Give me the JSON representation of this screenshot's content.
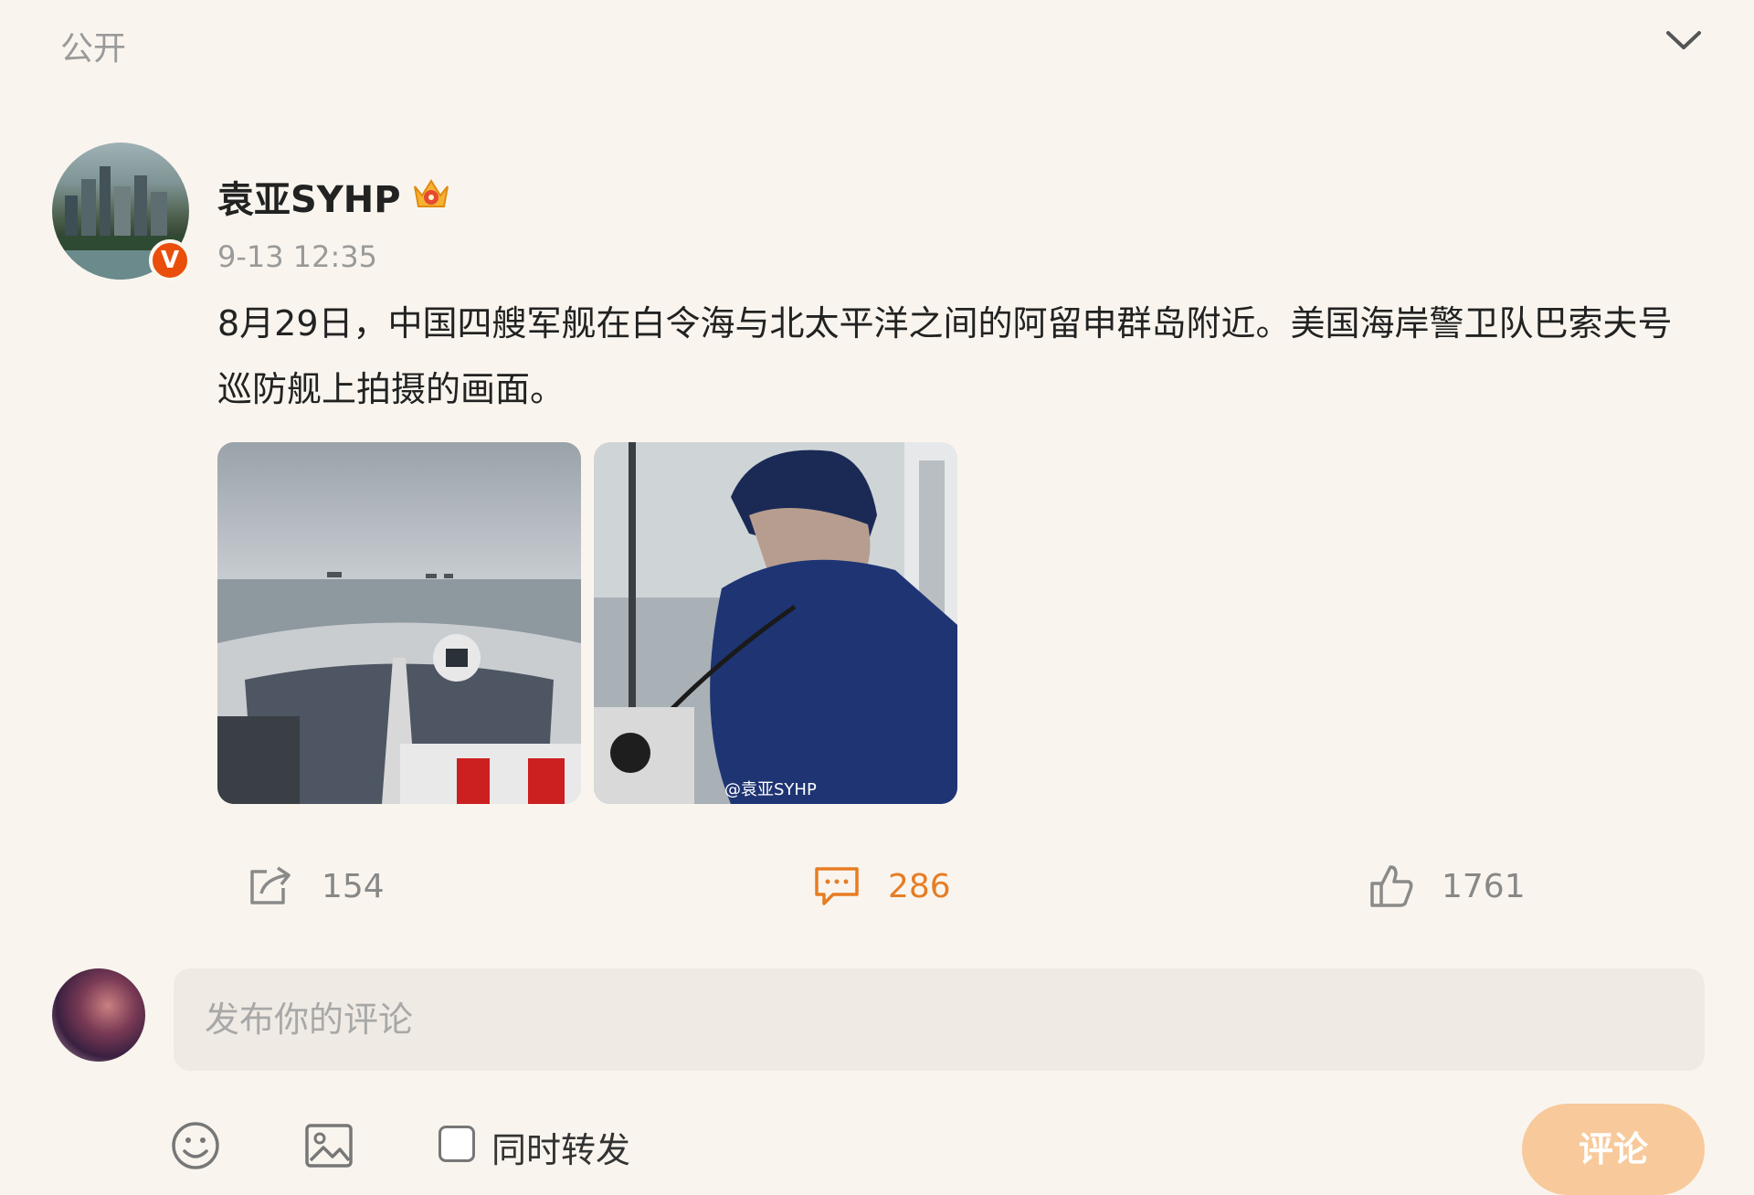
{
  "visibility": {
    "label": "公开",
    "icon": "chevron-down-icon"
  },
  "post": {
    "username": "袁亚SYHP",
    "badge_icon": "crown-icon",
    "verified_mark": "V",
    "timestamp": "9-13 12:35",
    "text": "8月29日，中国四艘军舰在白令海与北太平洋之间的阿留申群岛附近。美国海岸警卫队巴索夫号巡防舰上拍摄的画面。",
    "images": [
      {
        "icon": "ship-bow-photo"
      },
      {
        "icon": "crew-member-photo",
        "watermark": "@袁亚SYHP"
      }
    ]
  },
  "actions": {
    "share_count": "154",
    "comment_count": "286",
    "like_count": "1761",
    "comment_active_color": "#e77d24"
  },
  "compose": {
    "placeholder": "发布你的评论",
    "repost_label": "同时转发",
    "repost_checked": false,
    "submit_label": "评论",
    "submit_color": "#f8c99a"
  }
}
